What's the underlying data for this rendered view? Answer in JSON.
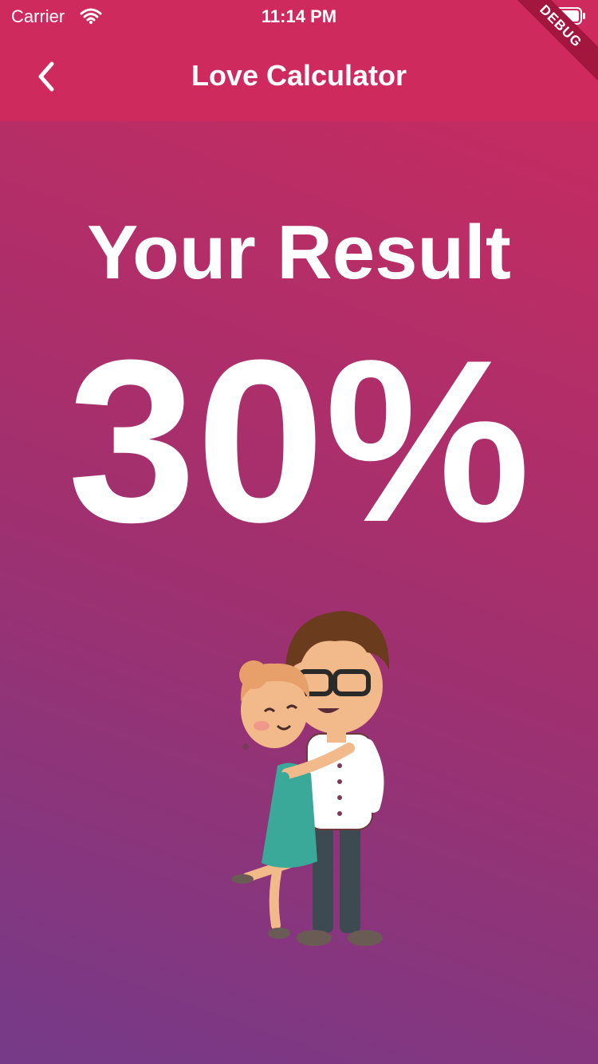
{
  "status_bar": {
    "carrier": "Carrier",
    "time": "11:14 PM"
  },
  "app_bar": {
    "title": "Love Calculator",
    "back_icon": "chevron-left-icon",
    "background": "#cf2a5d"
  },
  "debug_banner": "DEBUG",
  "result": {
    "label": "Your Result",
    "value": "30%"
  },
  "illustration": "couple-hugging-illustration",
  "colors": {
    "gradient_top": "#cc2b5e",
    "gradient_bottom": "#753a88",
    "text": "#ffffff"
  }
}
